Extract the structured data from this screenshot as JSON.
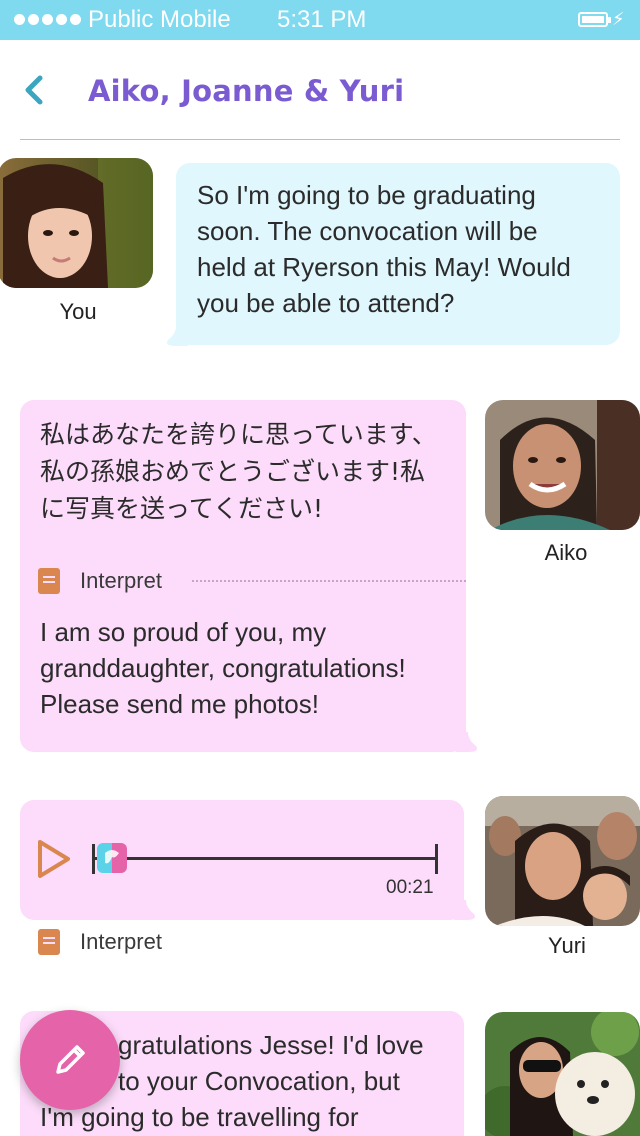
{
  "status_bar": {
    "carrier": "Public Mobile",
    "time": "5:31 PM",
    "battery": "battery-charging-icon"
  },
  "header": {
    "title": "Aiko, Joanne & Yuri",
    "back_icon": "chevron-left-icon"
  },
  "colors": {
    "status_bar": "#7fd9ef",
    "title": "#7a5bd1",
    "own_bubble": "#e0f7fd",
    "other_bubble": "#fcdcfa",
    "fab": "#e563a8",
    "accent_orange": "#d9864f"
  },
  "messages": [
    {
      "sender": "You",
      "text_lines": [
        "So I'm going to be graduating",
        "soon. The convocation will be",
        "held at Ryerson this May! Would",
        "you be able to attend?"
      ]
    },
    {
      "sender": "Aiko",
      "original_lines": [
        "私はあなたを誇りに思っています、",
        "私の孫娘おめでとうございます!私",
        "に写真を送ってください!"
      ],
      "interpret_label": "Interpret",
      "translation_lines": [
        "I am so proud of you, my",
        "granddaughter, congratulations!",
        "Please send me photos!"
      ]
    },
    {
      "sender": "Yuri",
      "audio_duration": "00:21",
      "interpret_label": "Interpret"
    },
    {
      "sender": "",
      "text_lines": [
        "gratulations Jesse! I'd love",
        "to your Convocation, but",
        "I'm going to be travelling for"
      ]
    }
  ],
  "fab": {
    "icon": "pencil-icon"
  }
}
